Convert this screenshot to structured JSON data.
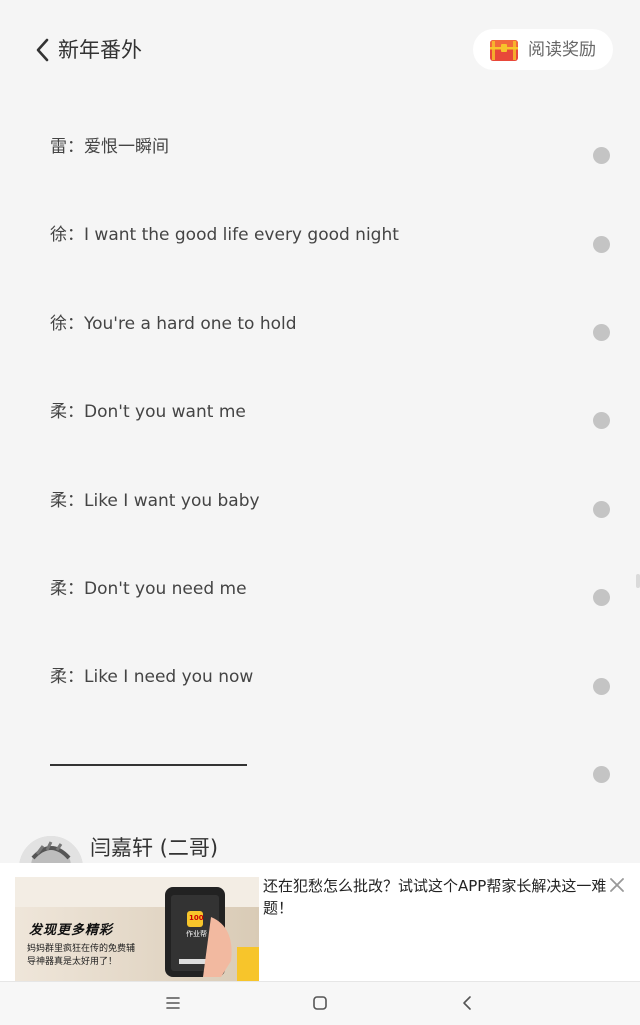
{
  "header": {
    "title": "新年番外",
    "reward_label": "阅读奖励"
  },
  "lines": [
    "雷：爱恨一瞬间",
    "徐：I want the good life every good night",
    "徐：You're a hard one to hold",
    "柔：Don't you want me",
    "柔：Like I want you baby",
    "柔：Don't you need me",
    "柔：Like I need you now"
  ],
  "author": {
    "name": "闫嘉轩 (二哥)"
  },
  "ad": {
    "text": "还在犯愁怎么批改？试试这个APP帮家长解决这一难题！",
    "thumb_headline": "发现更多精彩",
    "thumb_caption_1": "妈妈群里疯狂在传的免费辅",
    "thumb_caption_2": "导神器真是太好用了！",
    "thumb_app_name": "作业帮",
    "thumb_app_badge": "100"
  },
  "colors": {
    "background": "#f5f5f5",
    "dot": "#c4c4c4",
    "reward_chest": "#e8483a",
    "ad_accent": "#f7c52b"
  },
  "icons": [
    "back-icon",
    "treasure-chest-icon",
    "close-icon",
    "menu-icon",
    "home-icon",
    "nav-back-icon"
  ]
}
